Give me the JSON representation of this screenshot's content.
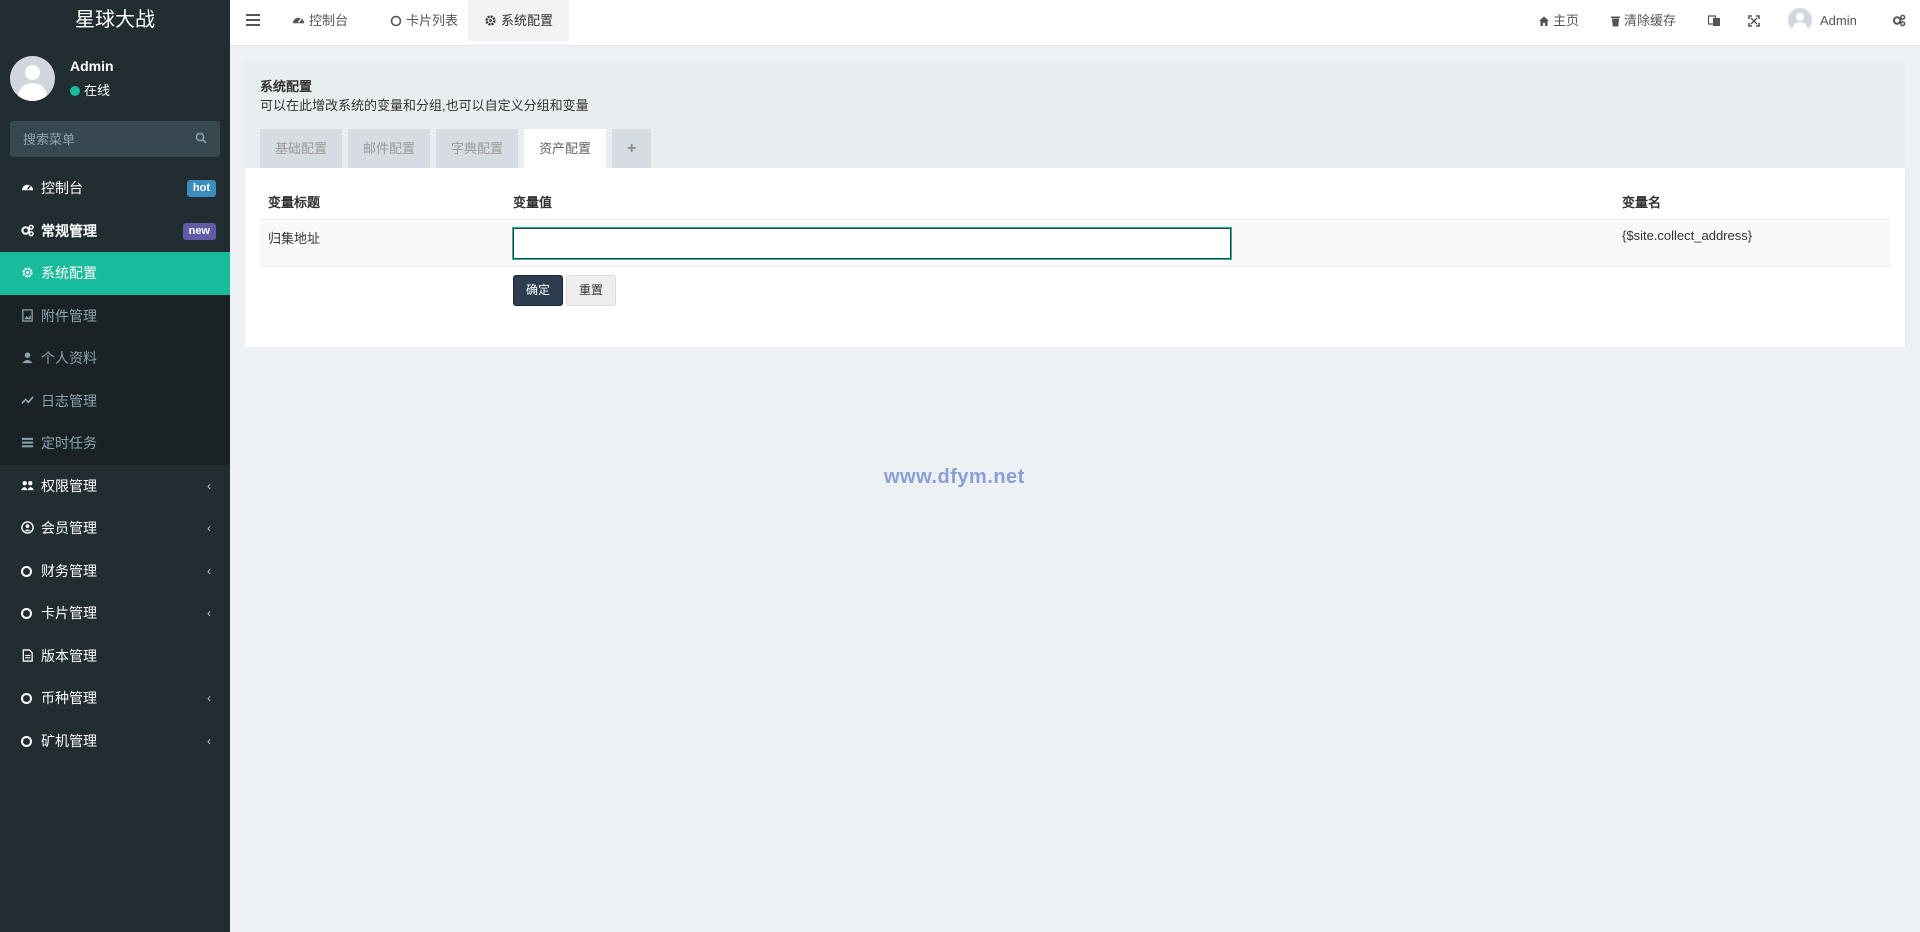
{
  "app": {
    "title": "星球大战"
  },
  "user": {
    "name": "Admin",
    "status": "在线"
  },
  "search": {
    "placeholder": "搜索菜单"
  },
  "sidebar": {
    "items": [
      {
        "label": "控制台",
        "badge": "hot",
        "icon": "dashboard-icon"
      },
      {
        "label": "常规管理",
        "badge": "new",
        "icon": "cogs-icon"
      },
      {
        "label": "系统配置",
        "icon": "gear-icon",
        "active": true
      },
      {
        "label": "附件管理",
        "icon": "file-image-icon",
        "sub": true
      },
      {
        "label": "个人资料",
        "icon": "user-icon",
        "sub": true
      },
      {
        "label": "日志管理",
        "icon": "log-icon",
        "sub": true
      },
      {
        "label": "定时任务",
        "icon": "tasks-icon",
        "sub": true
      },
      {
        "label": "权限管理",
        "icon": "group-icon",
        "expandable": true
      },
      {
        "label": "会员管理",
        "icon": "user-circle-icon",
        "expandable": true
      },
      {
        "label": "财务管理",
        "icon": "circle-icon",
        "expandable": true
      },
      {
        "label": "卡片管理",
        "icon": "circle-icon",
        "expandable": true
      },
      {
        "label": "版本管理",
        "icon": "file-text-icon"
      },
      {
        "label": "币种管理",
        "icon": "circle-icon",
        "expandable": true
      },
      {
        "label": "矿机管理",
        "icon": "circle-icon",
        "expandable": true
      }
    ]
  },
  "topbar": {
    "tabs": [
      {
        "label": "控制台",
        "icon": "dashboard-icon"
      },
      {
        "label": "卡片列表",
        "icon": "circle-icon"
      },
      {
        "label": "系统配置",
        "icon": "gear-icon",
        "active": true
      }
    ],
    "home_label": "主页",
    "clear_cache_label": "清除缓存",
    "user_label": "Admin"
  },
  "panel": {
    "title": "系统配置",
    "description": "可以在此增改系统的变量和分组,也可以自定义分组和变量",
    "tabs": [
      "基础配置",
      "邮件配置",
      "字典配置",
      "资产配置",
      "+"
    ],
    "active_tab": "资产配置",
    "columns": {
      "title": "变量标题",
      "value": "变量值",
      "name": "变量名"
    },
    "rows": [
      {
        "title": "归集地址",
        "value": "",
        "name": "{$site.collect_address}"
      }
    ],
    "submit_label": "确定",
    "reset_label": "重置"
  },
  "watermark": "www.dfym.net",
  "colors": {
    "sidebar_bg": "#222d32",
    "active": "#18bc9c",
    "primary_button": "#2c3e50",
    "hot_badge": "#3c8dbc",
    "new_badge": "#605ca8"
  }
}
